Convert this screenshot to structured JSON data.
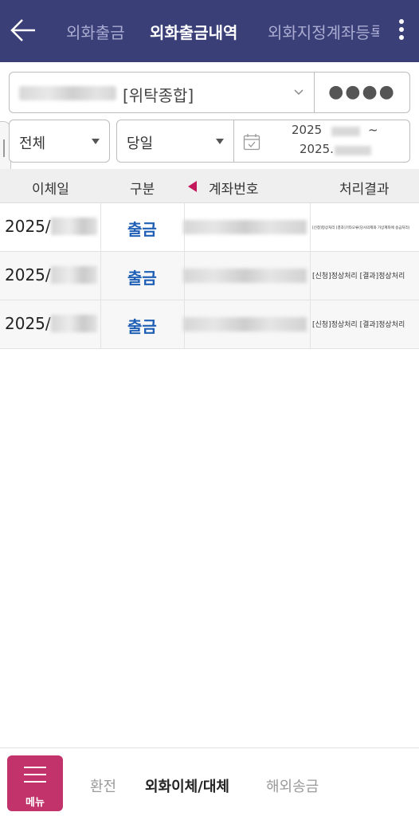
{
  "header": {
    "tabs": [
      {
        "label": "외화출금",
        "active": false
      },
      {
        "label": "외화출금내역",
        "active": true
      },
      {
        "label": "외화지정계좌등록",
        "active": false
      }
    ],
    "back_icon": "arrow-left-icon",
    "more_icon": "kebab-menu-icon",
    "bg_color": "#3a3f78"
  },
  "account": {
    "type_label": "[위탁종합]",
    "password_mask": "●●●●"
  },
  "filters": {
    "type_value": "전체",
    "period_value": "당일",
    "date_from": "2025",
    "date_to": "2025.",
    "date_separator": "~"
  },
  "table": {
    "columns": [
      "이체일",
      "구분",
      "계좌번호",
      "처리결과"
    ],
    "rows": [
      {
        "date": "2025/",
        "type": "출금",
        "result": "[신청]정상처리 [결과]기타오류(당사의제와 가상계좌에 송금처리)"
      },
      {
        "date": "2025/",
        "type": "출금",
        "result": "[신청]정상처리 [결과]정상처리"
      },
      {
        "date": "2025/",
        "type": "출금",
        "result": "[신청]정상처리 [결과]정상처리"
      }
    ],
    "accent_color": "#1f5fb5",
    "sort_marker_color": "#c2185b"
  },
  "bottom_nav": {
    "menu_label": "메뉴",
    "items": [
      {
        "label": "환전",
        "active": false
      },
      {
        "label": "외화이체/대체",
        "active": true
      },
      {
        "label": "해외송금",
        "active": false
      }
    ],
    "menu_color": "#c1336a"
  }
}
